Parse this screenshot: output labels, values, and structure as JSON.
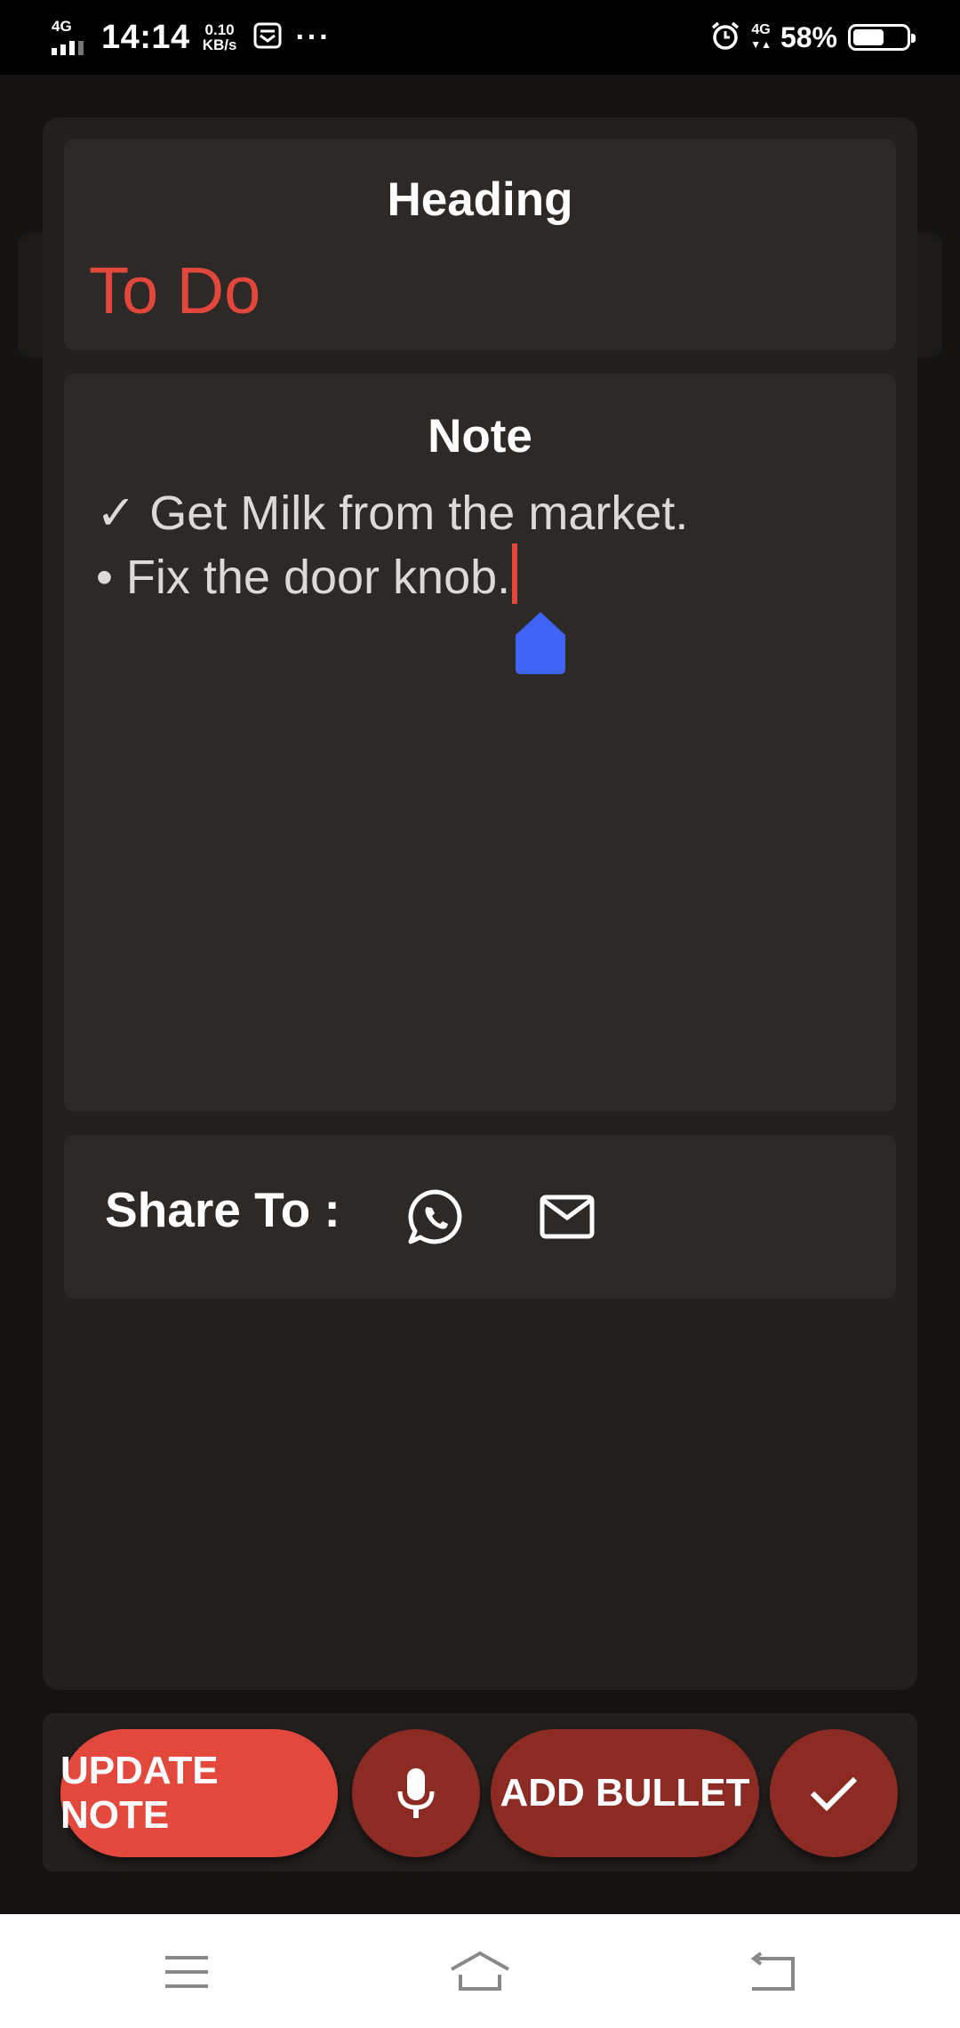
{
  "status_bar": {
    "network_type": "4G",
    "time": "14:14",
    "speed_value": "0.10",
    "speed_unit": "KB/s",
    "overflow": "···",
    "right_network": "4G",
    "battery_percent": "58%",
    "battery_level": 0.58
  },
  "dialog": {
    "heading_title": "Heading",
    "heading_value": "To Do",
    "note_title": "Note",
    "note_lines": [
      "✓ Get Milk from the market.",
      "• Fix the door knob."
    ],
    "share_label": "Share To :"
  },
  "actions": {
    "update_label": "UPDATE NOTE",
    "bullet_label": "ADD BULLET"
  },
  "colors": {
    "accent": "#e3473c",
    "button_dark": "#8c2a24",
    "card": "#2c2927",
    "handle": "#3f64f5"
  },
  "icons": [
    "whatsapp-icon",
    "email-icon",
    "microphone-icon",
    "checkmark-icon",
    "menu-icon",
    "home-icon",
    "back-icon",
    "alarm-icon",
    "message-icon"
  ]
}
